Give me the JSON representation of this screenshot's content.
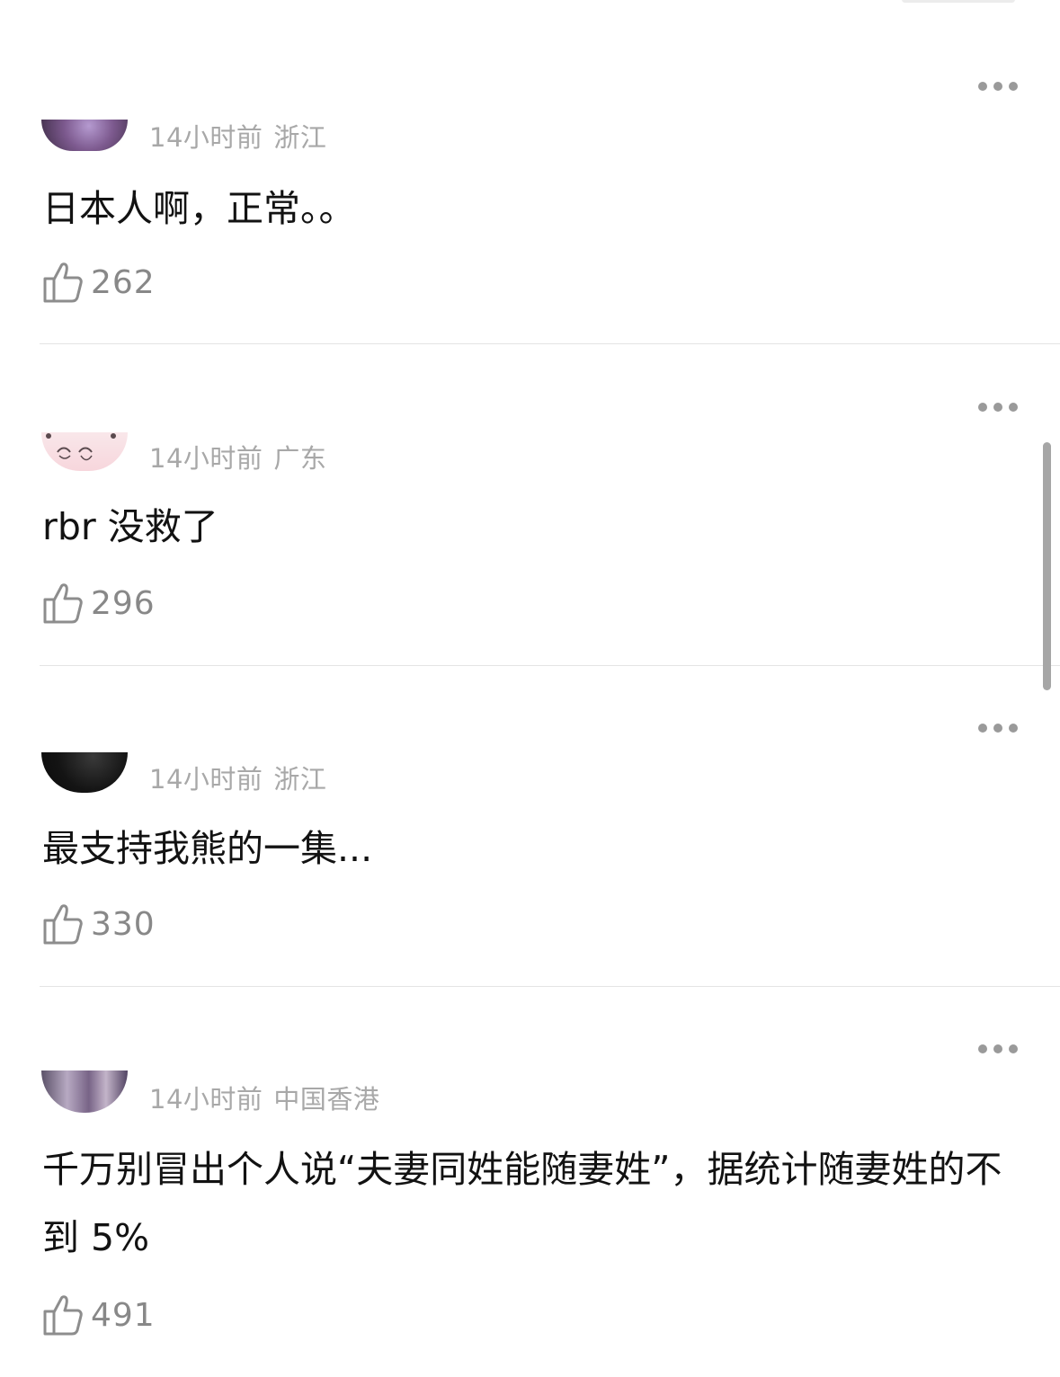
{
  "comments": [
    {
      "time": "14小时前",
      "region": "浙江",
      "text": "日本人啊，正常。。",
      "likes": "262",
      "avatar_icon": "purple-photo-avatar"
    },
    {
      "time": "14小时前",
      "region": "广东",
      "text": "rbr 没救了",
      "likes": "296",
      "avatar_icon": "pink-cartoon-avatar"
    },
    {
      "time": "14小时前",
      "region": "浙江",
      "text": "最支持我熊的一集...",
      "likes": "330",
      "avatar_icon": "dark-photo-avatar"
    },
    {
      "time": "14小时前",
      "region": "中国香港",
      "text": "千万别冒出个人说“夫妻同姓能随妻姓”，据统计随妻姓的不到 5%",
      "likes": "491",
      "avatar_icon": "illustration-avatar"
    }
  ],
  "icons": {
    "more": "more-dots-icon",
    "like": "thumbs-up-icon"
  },
  "colors": {
    "meta_text": "#a8a8a8",
    "like_text": "#888888",
    "divider": "#e4e4e4",
    "dots": "#9a9a9a"
  }
}
